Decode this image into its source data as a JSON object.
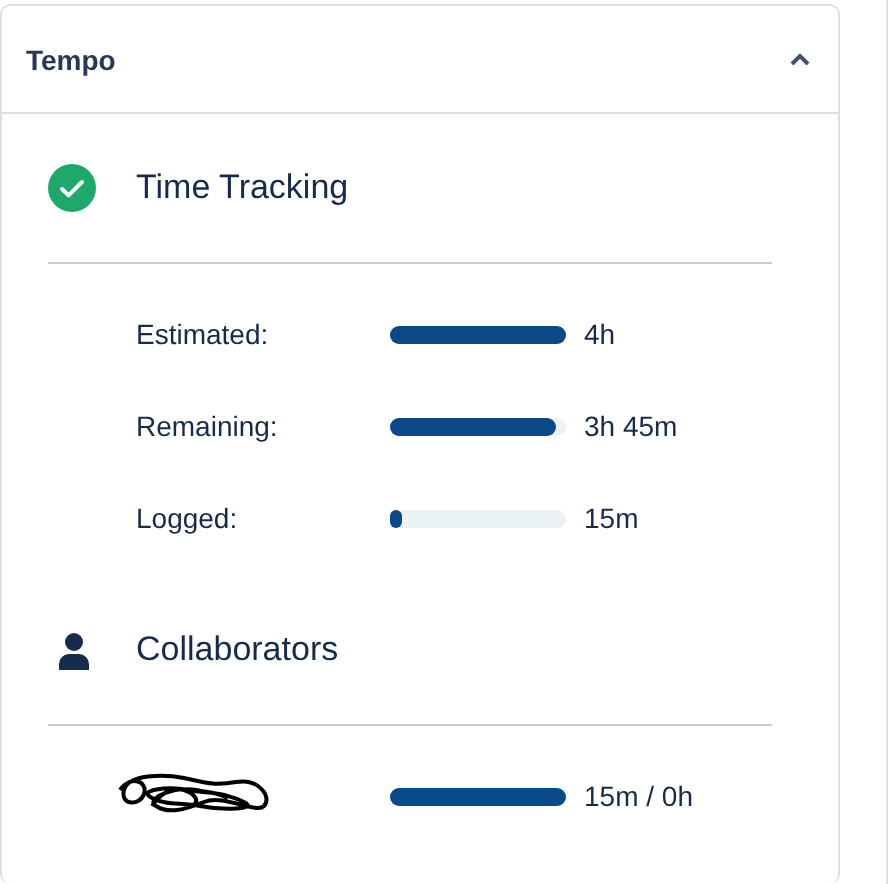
{
  "panel": {
    "title": "Tempo",
    "expanded": true
  },
  "time_tracking": {
    "title": "Time Tracking",
    "rows": [
      {
        "label": "Estimated:",
        "level": 1,
        "value": "4h"
      },
      {
        "label": "Remaining:",
        "level": 0.94,
        "value": "3h 45m"
      },
      {
        "label": "Logged:",
        "level": 0.07,
        "value": "15m"
      }
    ]
  },
  "collaborators": {
    "title": "Collaborators",
    "rows": [
      {
        "level": 1,
        "value": "15m / 0h"
      }
    ]
  }
}
